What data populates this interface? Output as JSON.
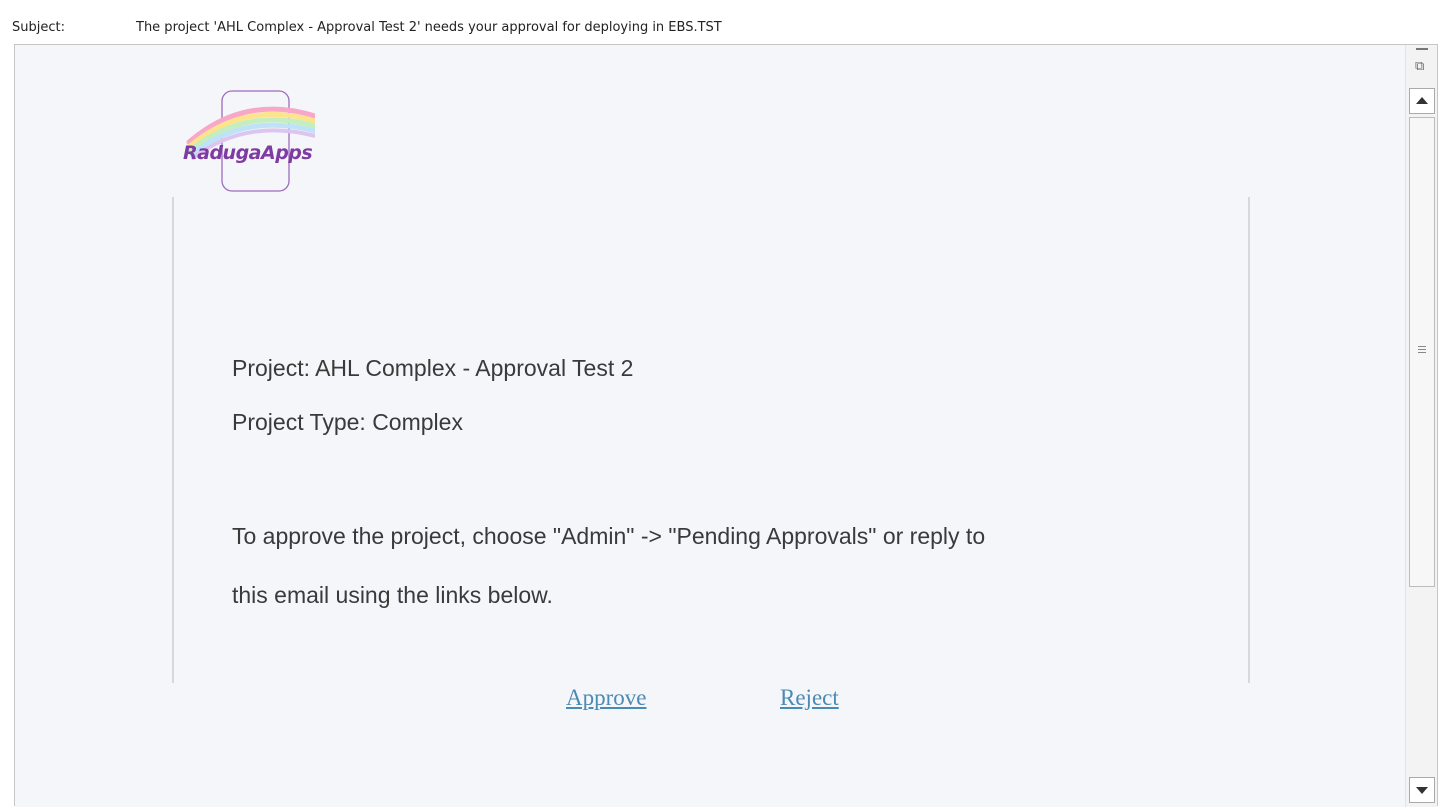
{
  "header": {
    "subject_label": "Subject:",
    "subject_text": "The project 'AHL Complex - Approval Test 2' needs your approval for deploying in EBS.TST"
  },
  "logo": {
    "text": "RadugaApps",
    "icon": "rainbow-logo-icon",
    "color": "#7e3ba1"
  },
  "email": {
    "project_line": "Project: AHL Complex - Approval Test 2",
    "project_type_line": "Project Type: Complex",
    "instruction_line1": "To approve the project, choose \"Admin\" -> \"Pending Approvals\" or reply to",
    "instruction_line2": "this email using the links below.",
    "approve_label": "Approve",
    "reject_label": "Reject",
    "link_color": "#4a8ab4"
  },
  "scrollbar": {
    "up_icon": "arrow-up-icon",
    "down_icon": "arrow-down-icon",
    "split_icon": "split-view-icon"
  }
}
